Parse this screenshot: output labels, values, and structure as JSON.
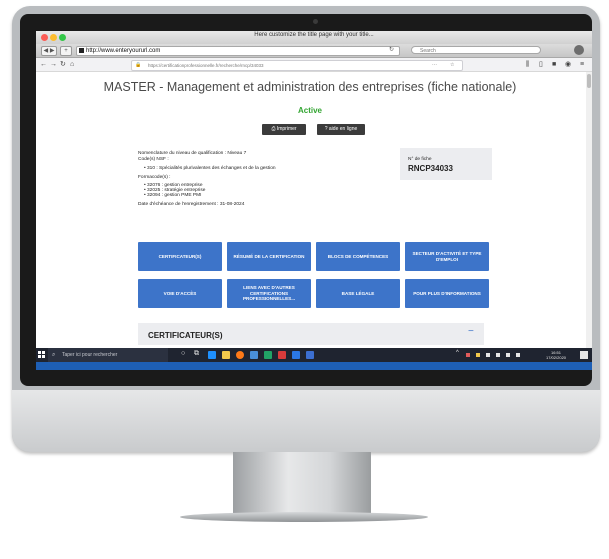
{
  "browser": {
    "window_title": "Here customize the title page with your title...",
    "mac_url": "http://www.enteryoururl.com",
    "mac_search_placeholder": "Search",
    "ff_url": "https://certificationprofessionnelle.fr/recherche/rncp/34033"
  },
  "page": {
    "title": "MASTER - Management et administration des entreprises (fiche nationale)",
    "status": "Active",
    "print_button": "Imprimer",
    "help_button": "aide en ligne",
    "level_line": "Nomenclature du niveau de qualification : Niveau 7",
    "nsf_label": "Code(s) NSF :",
    "nsf_items": [
      "310 : Spécialités plurivalentes des échanges et de la gestion"
    ],
    "formacode_label": "Formacode(s) :",
    "formacode_items": [
      "32076 : gestion entreprise",
      "32025 : stratégie entreprise",
      "32094 : gestion PME PMI"
    ],
    "deadline": "Date d'échéance de l'enregistrement : 31-08-2024",
    "fiche_label": "N° de fiche",
    "fiche_number": "RNCP34033",
    "tiles": [
      "CERTIFICATEUR(S)",
      "RÉSUMÉ DE LA CERTIFICATION",
      "BLOCS DE COMPÉTENCES",
      "SECTEUR D'ACTIVITÉ ET TYPE D'EMPLOI",
      "VOIE D'ACCÈS",
      "LIENS AVEC D'AUTRES CERTIFICATIONS PROFESSIONNELLES...",
      "BASE LÉGALE",
      "POUR PLUS D'INFORMATIONS"
    ],
    "section_title": "CERTIFICATEUR(S)",
    "section_toggle": "−"
  },
  "taskbar": {
    "search_placeholder": "Taper ici pour rechercher",
    "time": "16:51",
    "date": "17/02/2020"
  },
  "colors": {
    "tile_blue": "#3d74c9",
    "active_green": "#33a532",
    "taskbar": "#1f2430"
  }
}
